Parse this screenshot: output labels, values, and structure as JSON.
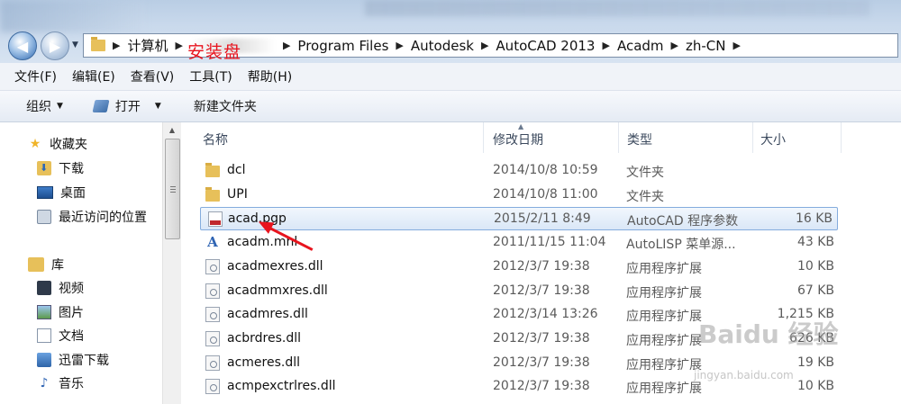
{
  "address": {
    "crumbs": [
      "计算机",
      "Program Files",
      "Autodesk",
      "AutoCAD 2013",
      "Acadm",
      "zh-CN"
    ],
    "annotation": "安装盘"
  },
  "menu": [
    "文件(F)",
    "编辑(E)",
    "查看(V)",
    "工具(T)",
    "帮助(H)"
  ],
  "command_bar": {
    "organize": "组织",
    "open": "打开",
    "new_folder": "新建文件夹"
  },
  "nav_pane": {
    "favorites": "收藏夹",
    "downloads": "下载",
    "desktop": "桌面",
    "recent": "最近访问的位置",
    "libraries": "库",
    "videos": "视频",
    "pictures": "图片",
    "documents": "文档",
    "xunlei": "迅雷下载",
    "music": "音乐"
  },
  "columns": {
    "name": "名称",
    "date": "修改日期",
    "type": "类型",
    "size": "大小"
  },
  "files": [
    {
      "name": "dcl",
      "date": "2014/10/8 10:59",
      "type": "文件夹",
      "size": "",
      "icon": "folder-icon"
    },
    {
      "name": "UPI",
      "date": "2014/10/8 11:00",
      "type": "文件夹",
      "size": "",
      "icon": "folder-icon"
    },
    {
      "name": "acad.pgp",
      "date": "2015/2/11 8:49",
      "type": "AutoCAD 程序参数",
      "size": "16 KB",
      "icon": "pgp-file-icon",
      "selected": true
    },
    {
      "name": "acadm.mnl",
      "date": "2011/11/15 11:04",
      "type": "AutoLISP 菜单源...",
      "size": "43 KB",
      "icon": "lisp-file-icon"
    },
    {
      "name": "acadmexres.dll",
      "date": "2012/3/7 19:38",
      "type": "应用程序扩展",
      "size": "10 KB",
      "icon": "dll-file-icon"
    },
    {
      "name": "acadmmxres.dll",
      "date": "2012/3/7 19:38",
      "type": "应用程序扩展",
      "size": "67 KB",
      "icon": "dll-file-icon"
    },
    {
      "name": "acadmres.dll",
      "date": "2012/3/14 13:26",
      "type": "应用程序扩展",
      "size": "1,215 KB",
      "icon": "dll-file-icon"
    },
    {
      "name": "acbrdres.dll",
      "date": "2012/3/7 19:38",
      "type": "应用程序扩展",
      "size": "626 KB",
      "icon": "dll-file-icon"
    },
    {
      "name": "acmeres.dll",
      "date": "2012/3/7 19:38",
      "type": "应用程序扩展",
      "size": "19 KB",
      "icon": "dll-file-icon"
    },
    {
      "name": "acmpexctrlres.dll",
      "date": "2012/3/7 19:38",
      "type": "应用程序扩展",
      "size": "10 KB",
      "icon": "dll-file-icon"
    }
  ],
  "watermark": {
    "brand": "Baidu 经验",
    "url": "jingyan.baidu.com"
  },
  "colors": {
    "annotation": "#e8141e",
    "selection_border": "#84acdd",
    "folder": "#e7c05a"
  }
}
